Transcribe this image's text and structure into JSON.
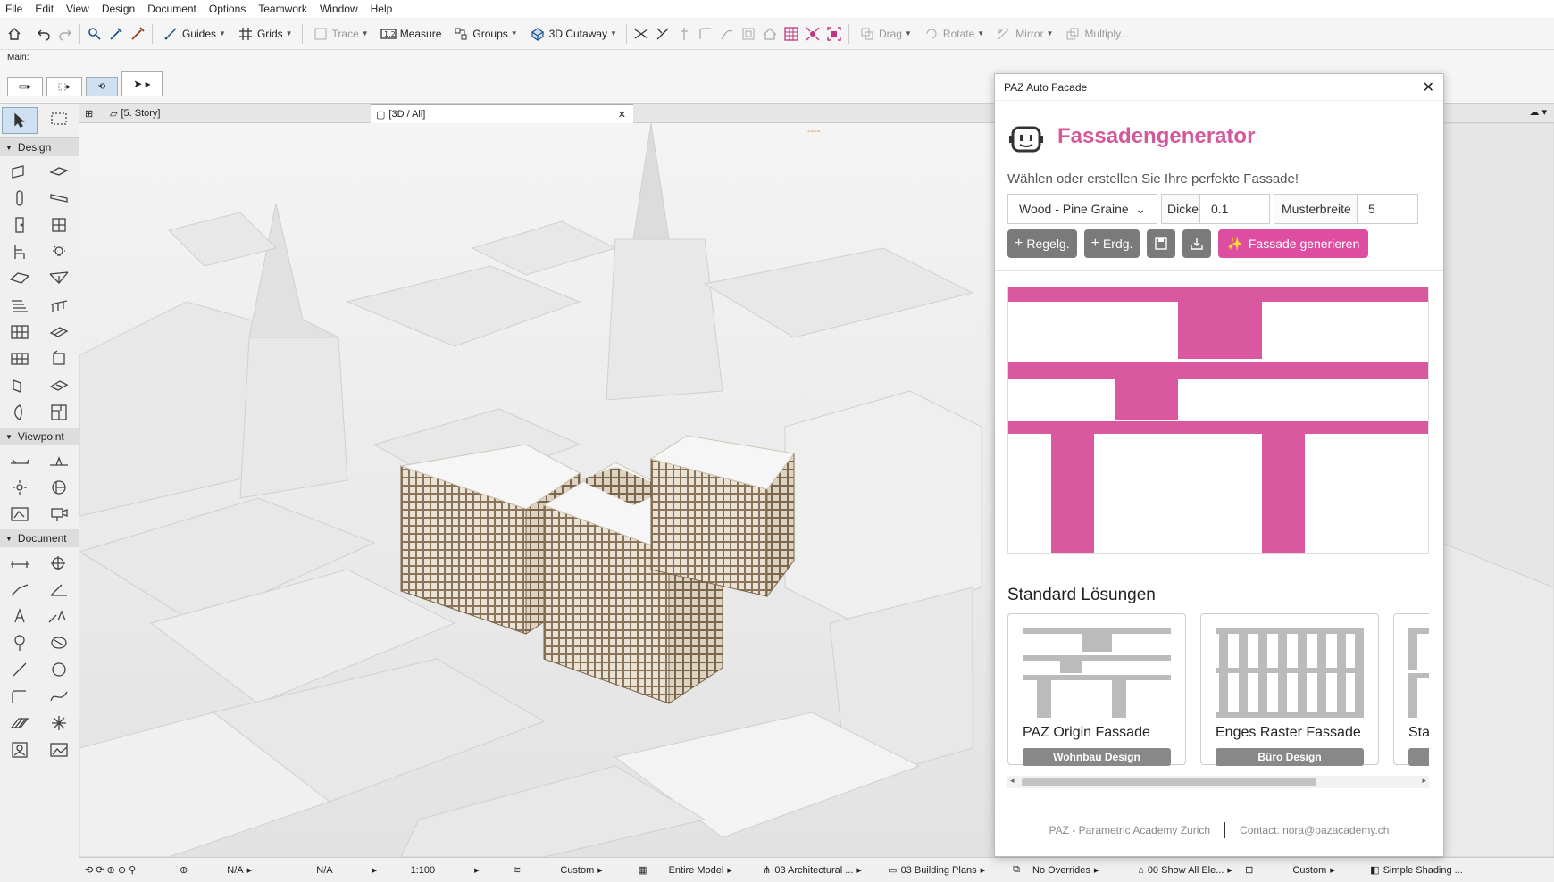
{
  "menu": [
    "File",
    "Edit",
    "View",
    "Design",
    "Document",
    "Options",
    "Teamwork",
    "Window",
    "Help"
  ],
  "toolbar": {
    "guides": "Guides",
    "grids": "Grids",
    "trace": "Trace",
    "measure": "Measure",
    "groups": "Groups",
    "cutaway": "3D Cutaway",
    "drag": "Drag",
    "rotate": "Rotate",
    "mirror": "Mirror",
    "multiply": "Multiply..."
  },
  "infobox": {
    "label": "Main:"
  },
  "toolbox": {
    "design": "Design",
    "viewpoint": "Viewpoint",
    "document": "Document"
  },
  "tabs": {
    "story": "[5. Story]",
    "view3d": "[3D / All]"
  },
  "status": {
    "na1": "N/A",
    "na2": "N/A",
    "scale": "1:100",
    "custom1": "Custom",
    "model": "Entire Model",
    "layer": "03 Architectural ...",
    "plans": "03 Building Plans",
    "overrides": "No Overrides",
    "show": "00 Show All Ele...",
    "custom2": "Custom",
    "shading": "Simple Shading ..."
  },
  "panel": {
    "window_title": "PAZ Auto Facade",
    "title": "Fassadengenerator",
    "subtitle": "Wählen oder erstellen Sie Ihre perfekte Fassade!",
    "material": "Wood - Pine Graine",
    "thickness_label": "Dicke",
    "thickness_value": "0.1",
    "pattern_label": "Musterbreite",
    "pattern_value": "5",
    "btn_regular": "Regelg.",
    "btn_ground": "Erdg.",
    "btn_generate": "Fassade generieren",
    "standard_title": "Standard Lösungen",
    "cards": [
      {
        "title": "PAZ Origin Fassade",
        "tag": "Wohnbau Design"
      },
      {
        "title": "Enges Raster Fassade",
        "tag": "Büro Design"
      },
      {
        "title": "Star",
        "tag": ""
      }
    ],
    "footer_org": "PAZ - Parametric Academy Zurich",
    "footer_contact": "Contact: nora@pazacademy.ch",
    "accent": "#dd4ea0"
  }
}
